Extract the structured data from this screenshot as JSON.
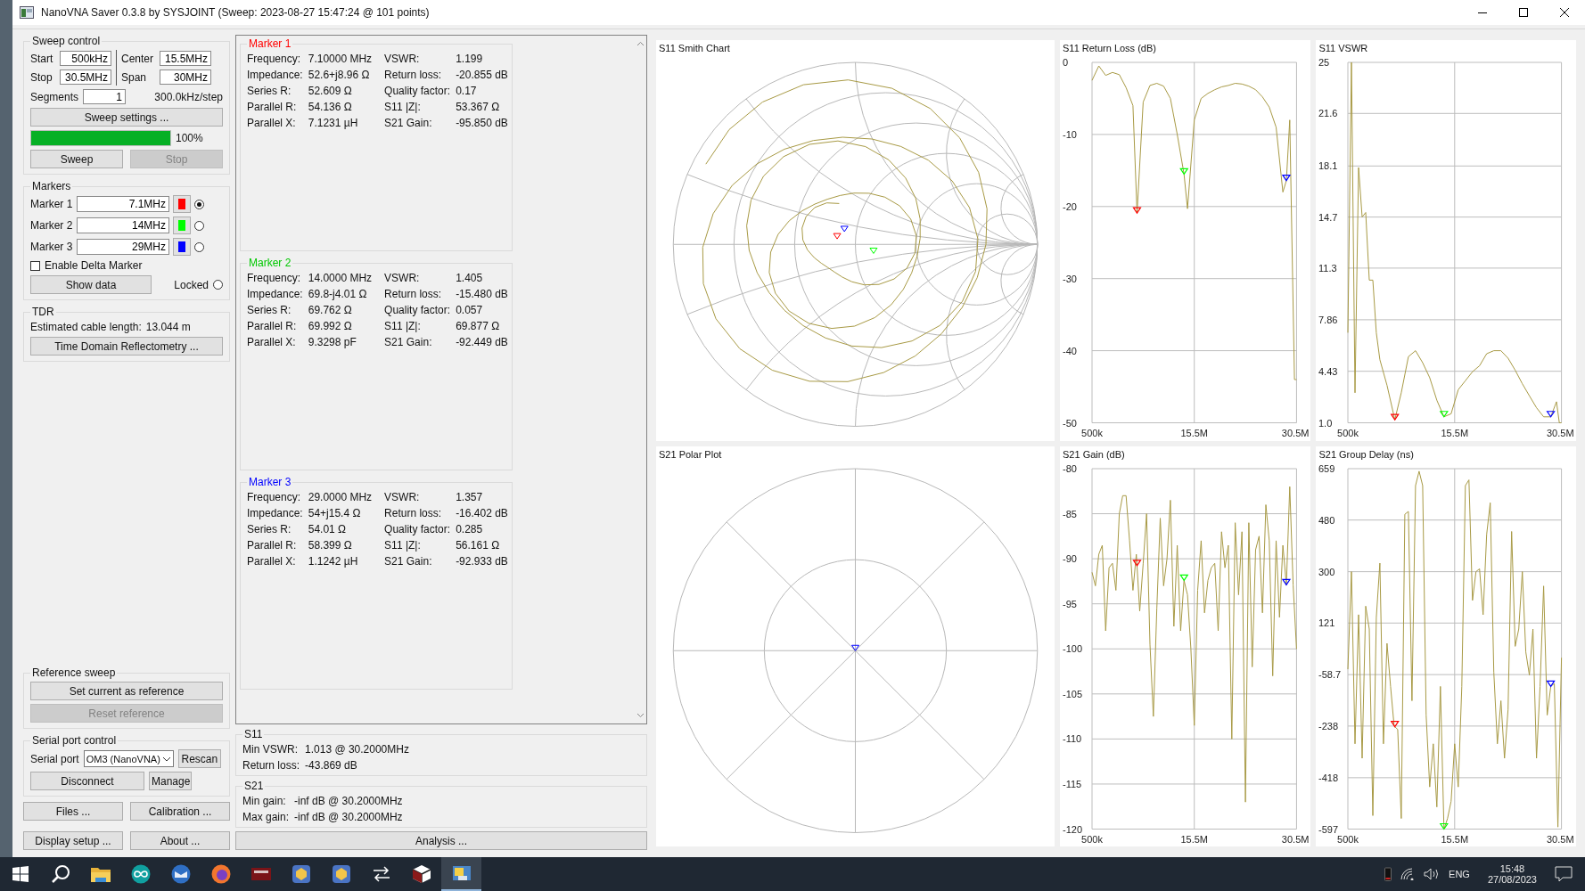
{
  "window": {
    "title": "NanoVNA Saver 0.3.8 by SYSJOINT (Sweep: 2023-08-27 15:47:24 @ 101 points)"
  },
  "sweep_control": {
    "title": "Sweep control",
    "fields": [
      {
        "label": "Start",
        "value": "500kHz"
      },
      {
        "label": "Center",
        "value": "15.5MHz"
      },
      {
        "label": "Stop",
        "value": "30.5MHz"
      },
      {
        "label": "Span",
        "value": "30MHz"
      }
    ],
    "segments": {
      "label": "Segments",
      "value": "1"
    },
    "step": "300.0kHz/step",
    "settings_button": "Sweep settings ...",
    "progress": {
      "level": 1,
      "reading": "100%"
    },
    "buttons": [
      {
        "label": "Sweep",
        "disabled": false
      },
      {
        "label": "Stop",
        "disabled": true
      }
    ]
  },
  "markers": {
    "title": "Markers",
    "items": [
      {
        "label": "Marker 1",
        "value": "7.1MHz",
        "color": "#ff0000",
        "selected": true
      },
      {
        "label": "Marker 2",
        "value": "14MHz",
        "color": "#00ff00",
        "selected": false
      },
      {
        "label": "Marker 3",
        "value": "29MHz",
        "color": "#0000ff",
        "selected": false
      }
    ],
    "delta": {
      "label": "Enable Delta Marker",
      "checked": false
    },
    "show_data_button": "Show data",
    "locked": {
      "label": "Locked",
      "selected": false
    }
  },
  "tdr": {
    "title": "TDR",
    "cable_label": "Estimated cable length:",
    "cable_value": "13.044 m",
    "button": "Time Domain Reflectometry ..."
  },
  "reference_sweep": {
    "title": "Reference sweep",
    "buttons": [
      {
        "label": "Set current as reference",
        "disabled": false
      },
      {
        "label": "Reset reference",
        "disabled": true
      }
    ]
  },
  "serial_port": {
    "title": "Serial port control",
    "port_label": "Serial port",
    "port_value": "OM3 (NanoVNA)",
    "buttons": [
      "Rescan",
      "Disconnect",
      "Manage"
    ]
  },
  "bottom_buttons": [
    "Files ...",
    "Calibration ...",
    "Display setup ...",
    "About ..."
  ],
  "marker_panels": [
    {
      "title": "Marker 1",
      "color": "#ff0000",
      "left": [
        {
          "label": "Frequency:",
          "value": "7.10000 MHz"
        },
        {
          "label": "Impedance:",
          "value": "52.6+j8.96 Ω"
        },
        {
          "label": "Series R:",
          "value": "52.609 Ω"
        },
        {
          "label": "Parallel R:",
          "value": "54.136 Ω"
        },
        {
          "label": "Parallel X:",
          "value": "7.1231 µH"
        }
      ],
      "right": [
        {
          "label": "VSWR:",
          "value": "1.199"
        },
        {
          "label": "Return loss:",
          "value": "-20.855 dB"
        },
        {
          "label": "Quality factor:",
          "value": "0.17"
        },
        {
          "label": "S11 |Z|:",
          "value": "53.367 Ω"
        },
        {
          "label": "S21 Gain:",
          "value": "-95.850 dB"
        }
      ]
    },
    {
      "title": "Marker 2",
      "color": "#00c800",
      "left": [
        {
          "label": "Frequency:",
          "value": "14.0000 MHz"
        },
        {
          "label": "Impedance:",
          "value": "69.8-j4.01 Ω"
        },
        {
          "label": "Series R:",
          "value": "69.762 Ω"
        },
        {
          "label": "Parallel R:",
          "value": "69.992 Ω"
        },
        {
          "label": "Parallel X:",
          "value": "9.3298 pF"
        }
      ],
      "right": [
        {
          "label": "VSWR:",
          "value": "1.405"
        },
        {
          "label": "Return loss:",
          "value": "-15.480 dB"
        },
        {
          "label": "Quality factor:",
          "value": "0.057"
        },
        {
          "label": "S11 |Z|:",
          "value": "69.877 Ω"
        },
        {
          "label": "S21 Gain:",
          "value": "-92.449 dB"
        }
      ]
    },
    {
      "title": "Marker 3",
      "color": "#0000ff",
      "left": [
        {
          "label": "Frequency:",
          "value": "29.0000 MHz"
        },
        {
          "label": "Impedance:",
          "value": "54+j15.4 Ω"
        },
        {
          "label": "Series R:",
          "value": "54.01 Ω"
        },
        {
          "label": "Parallel R:",
          "value": "58.399 Ω"
        },
        {
          "label": "Parallel X:",
          "value": "1.1242 µH"
        }
      ],
      "right": [
        {
          "label": "VSWR:",
          "value": "1.357"
        },
        {
          "label": "Return loss:",
          "value": "-16.402 dB"
        },
        {
          "label": "Quality factor:",
          "value": "0.285"
        },
        {
          "label": "S11 |Z|:",
          "value": "56.161 Ω"
        },
        {
          "label": "S21 Gain:",
          "value": "-92.933 dB"
        }
      ]
    }
  ],
  "s11_summary": {
    "title": "S11",
    "rows": [
      {
        "label": "Min VSWR:",
        "value": "1.013 @ 30.2000MHz"
      },
      {
        "label": "Return loss:",
        "value": "-43.869 dB"
      }
    ]
  },
  "s21_summary": {
    "title": "S21",
    "rows": [
      {
        "label": "Min gain:",
        "value": "-inf dB @ 30.2000MHz"
      },
      {
        "label": "Max gain:",
        "value": "-inf dB @ 30.2000MHz"
      }
    ]
  },
  "analysis_button": "Analysis ...",
  "charts": [
    {
      "kind": "smith",
      "title": "S11 Smith Chart"
    },
    {
      "kind": "line",
      "chart_data": {
        "type": "line",
        "title": "S11 Return Loss (dB)",
        "x": [
          500000,
          1500000,
          2500000,
          3500000,
          4500000,
          5500000,
          6500000,
          7100000,
          8000000,
          9000000,
          10000000,
          11000000,
          12000000,
          13000000,
          14000000,
          14500000,
          15500000,
          16500000,
          17500000,
          18500000,
          19500000,
          20500000,
          21500000,
          22500000,
          23500000,
          24500000,
          25500000,
          26500000,
          27500000,
          28500000,
          29000000,
          29500000,
          30200000,
          30500000
        ],
        "series": [
          {
            "color": "#a89a45",
            "values": [
              -2.5,
              -0.5,
              -1.8,
              -1.4,
              -1.7,
              -3.5,
              -6,
              -20.9,
              -5.5,
              -3.2,
              -2.9,
              -3.3,
              -5,
              -10,
              -15.5,
              -20.3,
              -8,
              -5,
              -4.3,
              -3.8,
              -3.4,
              -3.2,
              -2.9,
              -3,
              -3.3,
              -3.8,
              -4.8,
              -6.2,
              -9,
              -18,
              -16.4,
              -8,
              -44,
              -44
            ]
          }
        ],
        "xlim": [
          500000,
          30500000
        ],
        "ylim": [
          -50,
          0
        ],
        "grid": true,
        "xticks": [
          {
            "value": 500000,
            "label": "500k"
          },
          {
            "value": 15500000,
            "label": "15.5M"
          },
          {
            "value": 30500000,
            "label": "30.5M"
          }
        ],
        "yticks": [
          0,
          -10,
          -20,
          -30,
          -40,
          -50
        ]
      }
    },
    {
      "kind": "line",
      "chart_data": {
        "type": "line",
        "title": "S11 VSWR",
        "x": [
          500000,
          1000000,
          1500000,
          2000000,
          2500000,
          3000000,
          3500000,
          4000000,
          4500000,
          5000000,
          6000000,
          7100000,
          8000000,
          9000000,
          10000000,
          11000000,
          12000000,
          13000000,
          14000000,
          15000000,
          16000000,
          17000000,
          18000000,
          19000000,
          20000000,
          21000000,
          22000000,
          23000000,
          24000000,
          25000000,
          26000000,
          27000000,
          28000000,
          29000000,
          29800000,
          30200000,
          30500000
        ],
        "series": [
          {
            "color": "#a89a45",
            "values": [
              7,
              25,
              3,
              18,
              14.7,
              15,
              10.5,
              10.5,
              7,
              5.2,
              3.5,
              1.2,
              3,
              5.4,
              5.8,
              5,
              4,
              2.5,
              1.4,
              1.6,
              3.2,
              3.8,
              4.4,
              4.8,
              5.6,
              5.8,
              5.8,
              5.3,
              4.5,
              3.6,
              2.8,
              2,
              1.4,
              1.4,
              2.4,
              1,
              1
            ]
          }
        ],
        "xlim": [
          500000,
          30500000
        ],
        "ylim": [
          1,
          25
        ],
        "grid": true,
        "xticks": [
          {
            "value": 500000,
            "label": "500k"
          },
          {
            "value": 15500000,
            "label": "15.5M"
          },
          {
            "value": 30500000,
            "label": "30.5M"
          }
        ],
        "yticks": [
          25,
          21.6,
          18.1,
          14.7,
          11.3,
          7.86,
          4.43,
          {
            "value": 1,
            "label": "1.0"
          }
        ]
      }
    },
    {
      "kind": "polar",
      "title": "S21 Polar Plot"
    },
    {
      "kind": "line",
      "chart_data": {
        "type": "line",
        "title": "S21 Gain (dB)",
        "x": [
          500000,
          1000000,
          1500000,
          2000000,
          2500000,
          3000000,
          3500000,
          4000000,
          4500000,
          5000000,
          5500000,
          6000000,
          6500000,
          7000000,
          7500000,
          8000000,
          8500000,
          9000000,
          9500000,
          10000000,
          10500000,
          11000000,
          11500000,
          12000000,
          12500000,
          13000000,
          13500000,
          14000000,
          14500000,
          15000000,
          15500000,
          16000000,
          16500000,
          17000000,
          17500000,
          18000000,
          18500000,
          19000000,
          19500000,
          20000000,
          20500000,
          21000000,
          21500000,
          22000000,
          22500000,
          23000000,
          23500000,
          24000000,
          24500000,
          25000000,
          25500000,
          26000000,
          26500000,
          27000000,
          27500000,
          28000000,
          28500000,
          29000000,
          29500000,
          30000000,
          30500000
        ],
        "series": [
          {
            "color": "#a89a45",
            "values": [
              -91.5,
              -93,
              -89.5,
              -88.5,
              -98,
              -91,
              -90.5,
              -93.5,
              -85,
              -83,
              -83,
              -88,
              -93.5,
              -89.5,
              -95.8,
              -90.5,
              -85,
              -99.5,
              -107.5,
              -95.5,
              -85.5,
              -93,
              -90,
              -83.5,
              -97.5,
              -88.5,
              -98,
              -92.4,
              -94,
              -100,
              -108.5,
              -93.5,
              -88,
              -96,
              -92.4,
              -91,
              -90.5,
              -98,
              -87,
              -91,
              -88.5,
              -110,
              -86,
              -94,
              -87,
              -117,
              -86,
              -102,
              -89,
              -87.5,
              -96,
              -84,
              -88,
              -103,
              -88,
              -96.5,
              -88.5,
              -92.9,
              -82,
              -92.9,
              -100
            ]
          }
        ],
        "xlim": [
          500000,
          30500000
        ],
        "ylim": [
          -120,
          -80
        ],
        "grid": true,
        "xticks": [
          {
            "value": 500000,
            "label": "500k"
          },
          {
            "value": 15500000,
            "label": "15.5M"
          },
          {
            "value": 30500000,
            "label": "30.5M"
          }
        ],
        "yticks": [
          -80,
          -85,
          -90,
          -95,
          -100,
          -105,
          -110,
          -115,
          -120
        ]
      }
    },
    {
      "kind": "line",
      "chart_data": {
        "type": "line",
        "title": "S21 Group Delay (ns)",
        "x": [
          500000,
          1000000,
          1500000,
          2000000,
          2500000,
          3000000,
          3500000,
          4000000,
          4500000,
          5000000,
          5500000,
          6000000,
          6500000,
          7000000,
          7500000,
          8000000,
          8500000,
          9000000,
          9500000,
          10000000,
          10500000,
          11000000,
          11500000,
          12000000,
          12500000,
          13000000,
          13500000,
          14000000,
          14500000,
          15000000,
          15500000,
          16000000,
          16500000,
          17000000,
          17500000,
          18000000,
          18500000,
          19000000,
          19500000,
          20000000,
          20500000,
          21000000,
          21500000,
          22000000,
          22500000,
          23000000,
          23500000,
          24000000,
          24500000,
          25000000,
          25500000,
          26000000,
          26500000,
          27000000,
          27500000,
          28000000,
          28500000,
          29000000,
          29500000,
          30000000,
          30500000
        ],
        "series": [
          {
            "color": "#a89a45",
            "values": [
              -40,
              300,
              -300,
              150,
              -350,
              180,
              100,
              -550,
              140,
              330,
              -300,
              50,
              -100,
              -238,
              -250,
              -560,
              500,
              510,
              -150,
              600,
              650,
              600,
              -200,
              -450,
              -300,
              -520,
              -100,
              -597,
              -560,
              -500,
              -300,
              -450,
              -100,
              600,
              620,
              200,
              300,
              310,
              150,
              430,
              540,
              -50,
              -300,
              -150,
              -350,
              -180,
              440,
              40,
              100,
              300,
              20,
              -60,
              100,
              -350,
              -100,
              250,
              -200,
              -100,
              -90,
              -590,
              0
            ]
          }
        ],
        "xlim": [
          500000,
          30500000
        ],
        "ylim": [
          -597,
          659
        ],
        "grid": true,
        "xticks": [
          {
            "value": 500000,
            "label": "500k"
          },
          {
            "value": 15500000,
            "label": "15.5M"
          },
          {
            "value": 30500000,
            "label": "30.5M"
          }
        ],
        "yticks": [
          659,
          480,
          300,
          121,
          -58.7,
          -238,
          -418,
          -597
        ]
      }
    }
  ],
  "taskbar": {
    "apps": [
      {
        "kind": "start",
        "selected": false
      },
      {
        "kind": "search",
        "selected": false
      },
      {
        "kind": "folder",
        "selected": false
      },
      {
        "kind": "infinity",
        "selected": false
      },
      {
        "kind": "mail",
        "selected": false
      },
      {
        "kind": "fox",
        "selected": false
      },
      {
        "kind": "device",
        "selected": false
      },
      {
        "kind": "badge",
        "selected": false
      },
      {
        "kind": "badge",
        "selected": false
      },
      {
        "kind": "arrows",
        "selected": false
      },
      {
        "kind": "cube",
        "selected": false
      },
      {
        "kind": "window",
        "selected": true
      }
    ],
    "language": "ENG",
    "time": "15:48",
    "date": "27/08/2023"
  }
}
